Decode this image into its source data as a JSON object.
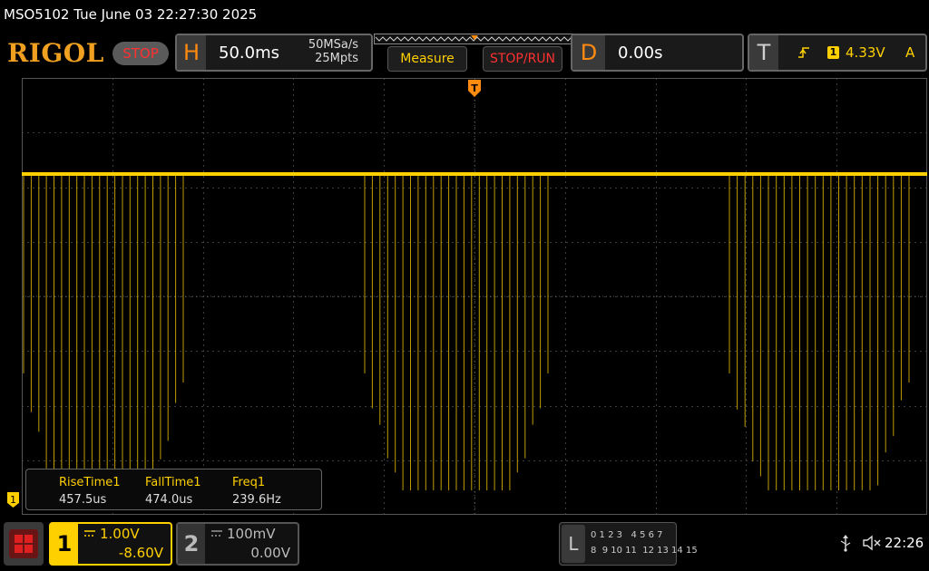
{
  "title": "MSO5102  Tue June 03 22:27:30 2025",
  "brand": "RIGOL",
  "run_state": "STOP",
  "horizontal": {
    "letter": "H",
    "timebase": "50.0ms",
    "sample_rate": "50MSa/s",
    "memory_depth": "25Mpts"
  },
  "buttons": {
    "measure": "Measure",
    "stop_run": "STOP/RUN"
  },
  "delay": {
    "letter": "D",
    "value": "0.00s"
  },
  "trigger": {
    "letter": "T",
    "source": "1",
    "level": "4.33V",
    "mode": "A",
    "marker": "T"
  },
  "measurements": {
    "labels": [
      "RiseTime1",
      "FallTime1",
      "Freq1"
    ],
    "values": [
      "457.5us",
      "474.0us",
      "239.6Hz"
    ]
  },
  "channel1": {
    "number": "1",
    "scale": "1.00V",
    "offset": "-8.60V",
    "marker": "1"
  },
  "channel2": {
    "number": "2",
    "scale": "100mV",
    "offset": "0.00V"
  },
  "logic": {
    "letter": "L",
    "row1": "0 1 2 3   4 5 6 7",
    "row2": "8  9 10 11  12 13 14 15"
  },
  "status": {
    "time": "22:26"
  },
  "colors": {
    "channel1": "#ffd000",
    "accent": "#ff8a10",
    "stop": "#ff3030",
    "grid": "#3c3c3c"
  },
  "icons": {
    "usb": "usb-icon",
    "speaker": "speaker-muted-icon",
    "menu": "menu-grid-icon"
  }
}
